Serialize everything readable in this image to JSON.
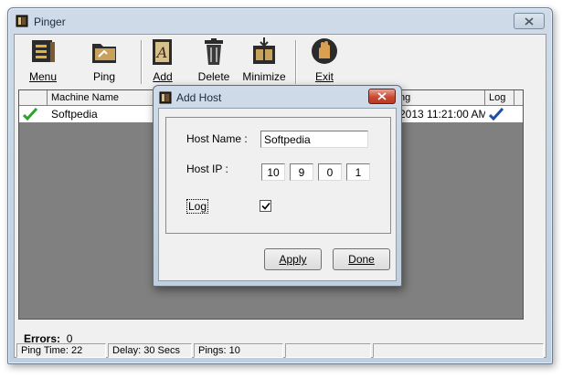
{
  "window": {
    "title": "Pinger"
  },
  "toolbar": {
    "buttons": [
      {
        "id": "menu",
        "label": "Menu",
        "icon": "menu-icon"
      },
      {
        "id": "ping",
        "label": "Ping",
        "icon": "folder-icon"
      },
      {
        "id": "add",
        "label": "Add",
        "icon": "add-document-icon"
      },
      {
        "id": "delete",
        "label": "Delete",
        "icon": "trash-icon"
      },
      {
        "id": "minimize",
        "label": "Minimize",
        "icon": "minimize-box-icon"
      },
      {
        "id": "exit",
        "label": "Exit",
        "icon": "stop-hand-icon"
      }
    ]
  },
  "list": {
    "columns": [
      "Machine Name",
      "ng",
      "Log"
    ],
    "rows": [
      {
        "machine": "Softpedia",
        "time": "2013 11:21:00 AM"
      }
    ]
  },
  "errors": {
    "label": "Errors:",
    "count": "0"
  },
  "statusbar": [
    "Ping Time: 22",
    "Delay: 30 Secs",
    "Pings: 10"
  ],
  "dialog": {
    "title": "Add Host",
    "host_name_label": "Host Name :",
    "host_name_value": "Softpedia",
    "host_ip_label": "Host IP :",
    "ip": [
      "10",
      "9",
      "0",
      "1"
    ],
    "log_label": "Log",
    "log_checked": true,
    "apply_label": "Apply",
    "done_label": "Done"
  },
  "colors": {
    "green_check": "#2ea12e",
    "blue_check": "#1f4fa8",
    "close_red": "#c94a34"
  }
}
